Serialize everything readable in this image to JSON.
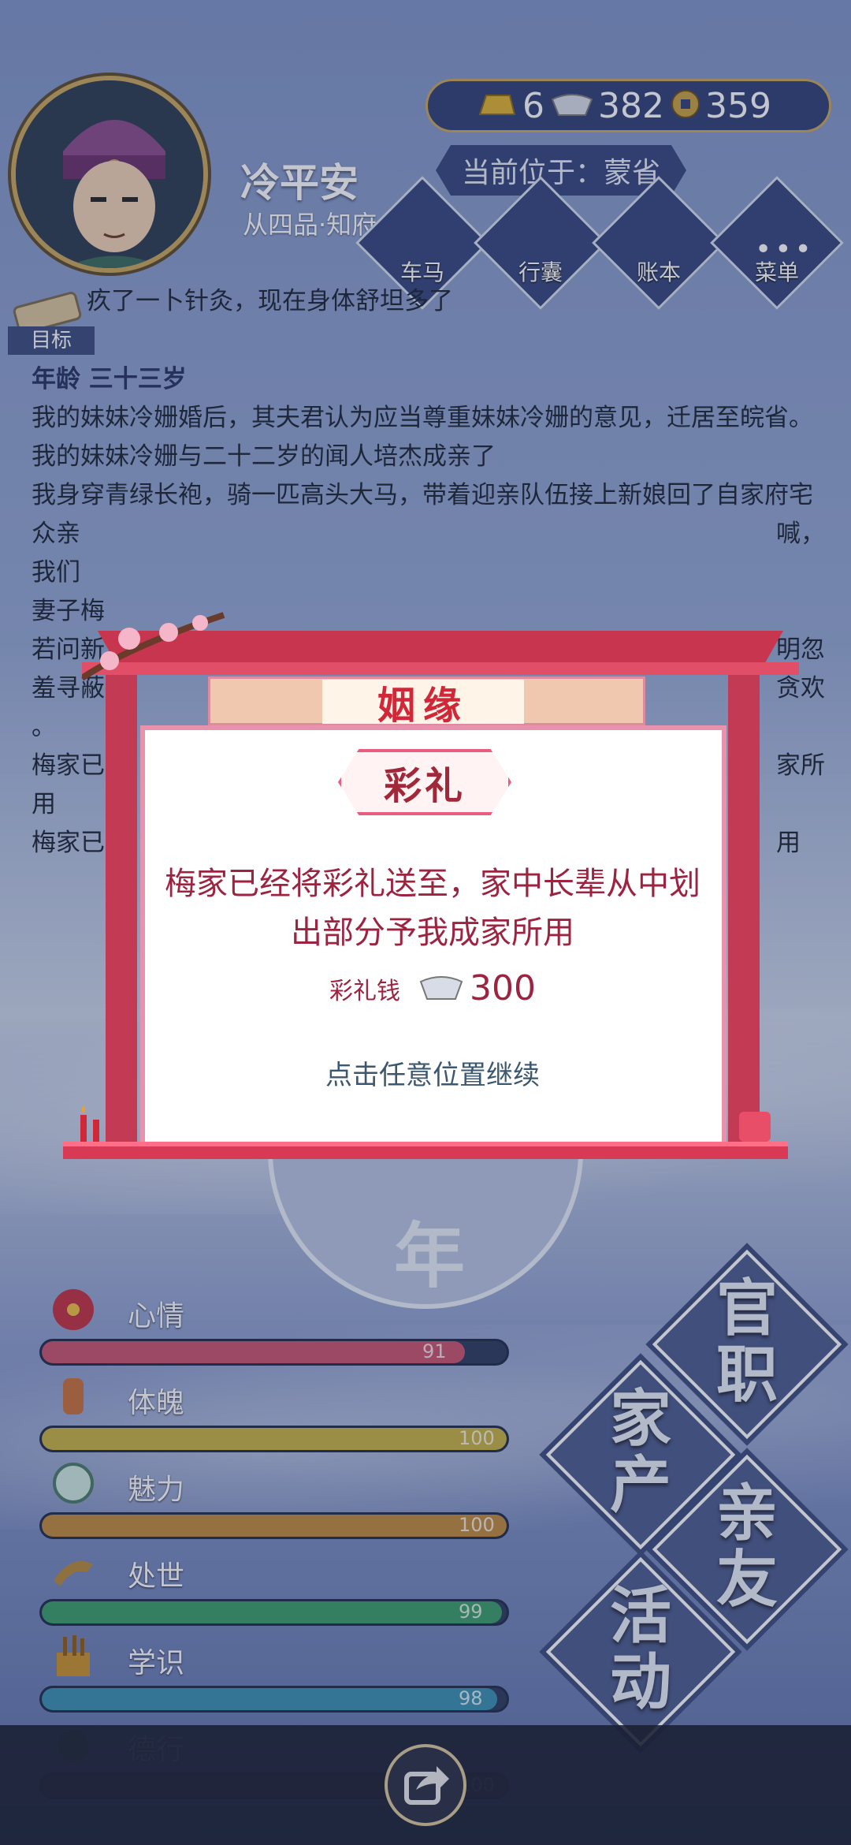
{
  "player": {
    "name": "冷平安",
    "rank": "从四品·知府"
  },
  "resources": {
    "gold": "6",
    "silver": "382",
    "coin": "359"
  },
  "location": "当前位于：蒙省",
  "nav": {
    "carriage": "车马",
    "bag": "行囊",
    "ledger": "账本",
    "menu": "菜单"
  },
  "goal_label": "目标",
  "log": {
    "top_line": "疚了一卜针灸，现在身体舒坦多了",
    "age_title": "年龄 三十三岁",
    "entries": [
      "我的妹妹冷姗婚后，其夫君认为应当尊重妹妹冷姗的意见，迁居至皖省。",
      "我的妹妹冷姗与二十二岁的闻人培杰成亲了",
      "我身穿青绿长袍，骑一匹高头大马，带着迎亲队伍接上新娘回了自家府宅"
    ],
    "right_fragments": [
      "喊，",
      "明忽",
      "贪欢",
      "家所",
      "用"
    ],
    "left_fragments": [
      "众亲",
      "我们",
      "妻子梅",
      "若问新",
      "羞寻蔽",
      "。",
      "梅家已",
      "用",
      "梅家已"
    ]
  },
  "modal": {
    "title": "姻缘",
    "subtitle": "彩礼",
    "message": "梅家已经将彩礼送至，家中长辈从中划出部分予我成家所用",
    "gift_label": "彩礼钱",
    "gift_value": "300",
    "continue": "点击任意位置继续"
  },
  "center_year": "年",
  "stats": [
    {
      "name": "心情",
      "value": "91",
      "fill": 0.91,
      "color": "#c9536e"
    },
    {
      "name": "体魄",
      "value": "100",
      "fill": 1.0,
      "color": "#c7b042"
    },
    {
      "name": "魅力",
      "value": "100",
      "fill": 1.0,
      "color": "#c08a3c"
    },
    {
      "name": "处世",
      "value": "99",
      "fill": 0.99,
      "color": "#3a9c6a"
    },
    {
      "name": "学识",
      "value": "98",
      "fill": 0.98,
      "color": "#3a8fb0"
    },
    {
      "name": "德行",
      "value": "100",
      "fill": 1.0,
      "color": "#7a3a5a"
    }
  ],
  "actions": {
    "office": "官职",
    "estate": "家产",
    "family": "亲友",
    "activity": "活动"
  }
}
